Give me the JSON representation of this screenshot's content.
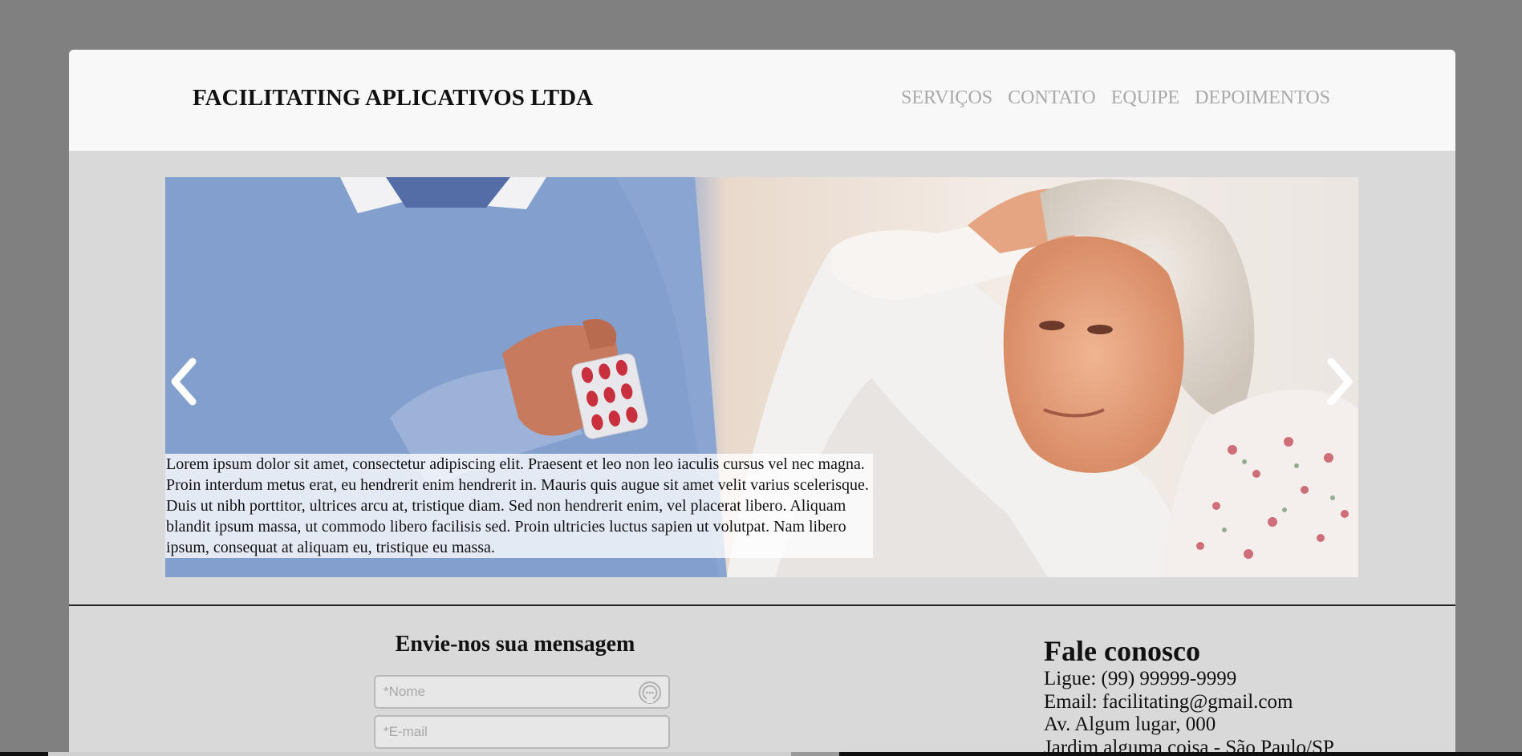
{
  "header": {
    "brand": "FACILITATING APLICATIVOS LTDA",
    "nav": [
      "SERVIÇOS",
      "CONTATO",
      "EQUIPE",
      "DEPOIMENTOS"
    ]
  },
  "carousel": {
    "caption": "Lorem ipsum dolor sit amet, consectetur adipiscing elit. Praesent et leo non leo iaculis cursus vel nec magna. Proin interdum metus erat, eu hendrerit enim hendrerit in. Mauris quis augue sit amet velit varius scelerisque. Duis ut nibh porttitor, ultrices arcu at, tristique diam. Sed non hendrerit enim, vel placerat libero. Aliquam blandit ipsum massa, ut commodo libero facilisis sed. Proin ultricies luctus sapien ut volutpat. Nam libero ipsum, consequat at aliquam eu, tristique eu massa.",
    "prev_icon": "chevron-left-icon",
    "next_icon": "chevron-right-icon"
  },
  "form": {
    "title": "Envie-nos sua mensagem",
    "name_placeholder": "*Nome",
    "email_placeholder": "*E-mail",
    "autofill_icon": "autofill-icon"
  },
  "contact": {
    "title": "Fale conosco",
    "phone": "Ligue: (99) 99999-9999",
    "email": "Email: facilitating@gmail.com",
    "address": "Av. Algum lugar, 000",
    "district": "Jardim alguma coisa - São Paulo/SP"
  },
  "colors": {
    "backdrop": "#808080",
    "header_bg": "#f8f8f8",
    "page_bg": "#d9d9d9",
    "nav_text": "#a9a9a9"
  }
}
